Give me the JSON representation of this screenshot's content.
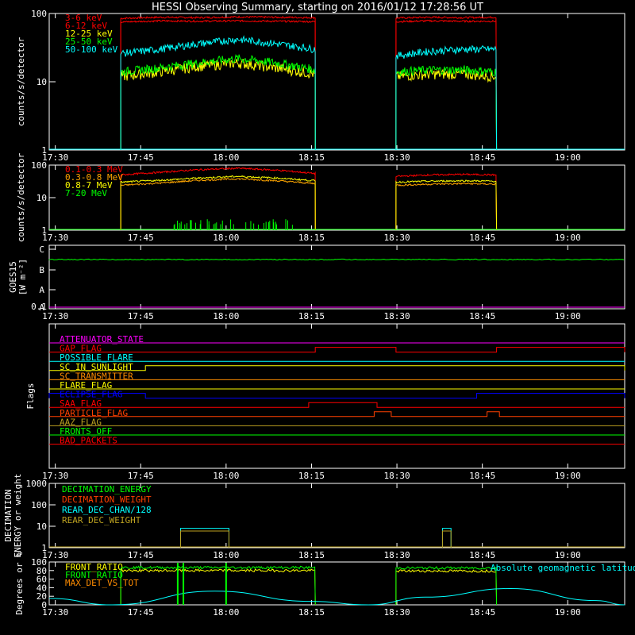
{
  "title": "HESSI Observing Summary, starting on 2016/01/12 17:28:56 UT",
  "time_ticks": [
    "17:30",
    "17:45",
    "18:00",
    "18:15",
    "18:30",
    "18:45",
    "19:00"
  ],
  "colors": {
    "red": "#ff0000",
    "orange": "#ff8c00",
    "yellow": "#ffff00",
    "green": "#00ff00",
    "cyan": "#00ffff",
    "magenta": "#ff00ff",
    "blue": "#0000ff",
    "olive": "#bba020",
    "white": "#ffffff"
  },
  "chart_data": [
    {
      "type": "line",
      "name": "lightcurve-low",
      "ylabel": "counts/s/detector",
      "yscale": "log",
      "ylim": [
        1,
        100
      ],
      "ytick_labels": [
        "1",
        "10",
        "100"
      ],
      "xlim": [
        "17:28:56",
        "19:10:00"
      ],
      "series": [
        {
          "name": "3-6 keV",
          "color": "#ff0000",
          "segments": [
            {
              "start": "17:41:30",
              "end": "18:15:40",
              "values": [
                85,
                88,
                87,
                89,
                88,
                87
              ]
            },
            {
              "start": "18:29:50",
              "end": "18:47:30",
              "values": [
                86,
                88,
                87,
                88
              ]
            }
          ]
        },
        {
          "name": "6-12 keV",
          "color": "#ff0000",
          "segments": [
            {
              "start": "17:41:30",
              "end": "18:15:40",
              "values": [
                75,
                78,
                77,
                78,
                77,
                76
              ]
            },
            {
              "start": "18:29:50",
              "end": "18:47:30",
              "values": [
                76,
                78,
                77,
                77
              ]
            }
          ]
        },
        {
          "name": "12-25 keV",
          "color": "#ffff00",
          "segments": [
            {
              "start": "17:41:30",
              "end": "18:15:40",
              "values": [
                12,
                14,
                17,
                19,
                16,
                13
              ]
            },
            {
              "start": "18:29:50",
              "end": "18:47:30",
              "values": [
                12,
                13,
                13,
                12
              ]
            }
          ]
        },
        {
          "name": "25-50 keV",
          "color": "#00ff00",
          "segments": [
            {
              "start": "17:41:30",
              "end": "18:15:40",
              "values": [
                14,
                16,
                19,
                22,
                19,
                15
              ]
            },
            {
              "start": "18:29:50",
              "end": "18:47:30",
              "values": [
                14,
                15,
                15,
                14
              ]
            }
          ]
        },
        {
          "name": "50-100 keV",
          "color": "#00ffff",
          "segments": [
            {
              "start": "17:41:30",
              "end": "18:15:40",
              "values": [
                26,
                30,
                36,
                42,
                36,
                30
              ]
            },
            {
              "start": "18:29:50",
              "end": "18:47:30",
              "values": [
                24,
                28,
                30,
                30
              ]
            }
          ]
        }
      ]
    },
    {
      "type": "line",
      "name": "lightcurve-high",
      "ylabel": "counts/s/detector",
      "yscale": "log",
      "ylim": [
        1,
        100
      ],
      "ytick_labels": [
        "1",
        "10",
        "100"
      ],
      "series": [
        {
          "name": "0.1-0.3 MeV",
          "color": "#ff0000",
          "segments": [
            {
              "start": "17:41:30",
              "end": "18:15:40",
              "values": [
                50,
                60,
                72,
                80,
                70,
                55
              ]
            },
            {
              "start": "18:29:50",
              "end": "18:47:30",
              "values": [
                45,
                50,
                52,
                50
              ]
            }
          ]
        },
        {
          "name": "0.3-0.8 MeV",
          "color": "#ffa500",
          "segments": [
            {
              "start": "17:41:30",
              "end": "18:15:40",
              "values": [
                24,
                28,
                34,
                38,
                33,
                27
              ]
            },
            {
              "start": "18:29:50",
              "end": "18:47:30",
              "values": [
                24,
                26,
                27,
                26
              ]
            }
          ]
        },
        {
          "name": "0.8-7 MeV",
          "color": "#ffff00",
          "segments": [
            {
              "start": "17:41:30",
              "end": "18:15:40",
              "values": [
                30,
                34,
                40,
                45,
                40,
                33
              ]
            },
            {
              "start": "18:29:50",
              "end": "18:47:30",
              "values": [
                30,
                32,
                33,
                32
              ]
            }
          ]
        },
        {
          "name": "7-20 MeV",
          "color": "#00ff00",
          "segments": []
        }
      ]
    },
    {
      "type": "line",
      "name": "goes",
      "ylabel": "GOES15",
      "ylabel2": "[W m⁻²]",
      "ytick_labels": [
        "A",
        "A",
        "B",
        "C"
      ],
      "ytick_prefix": "0.1",
      "series": [
        {
          "name": "GOES15 flux",
          "color": "#00ff00",
          "level_class": "B-high",
          "values_start": "17:28:56",
          "values_end": "19:10:00"
        }
      ],
      "baseline_color": "#ff00ff"
    },
    {
      "type": "line",
      "name": "flags",
      "ylabel": "Flags",
      "series": [
        {
          "name": "ATTENUATOR_STATE",
          "color": "#ff00ff",
          "on": []
        },
        {
          "name": "GAP_FLAG",
          "color": "#ff0000",
          "on": [
            [
              "18:15:40",
              "18:29:50"
            ],
            [
              "18:47:30",
              "19:10:00"
            ]
          ]
        },
        {
          "name": "POSSIBLE_FLARE",
          "color": "#00ffff",
          "on": []
        },
        {
          "name": "SC_IN_SUNLIGHT",
          "color": "#ffff00",
          "on": [
            [
              "17:45:50",
              "19:10:00"
            ]
          ]
        },
        {
          "name": "SC_TRANSMITTER",
          "color": "#ff8c00",
          "on": []
        },
        {
          "name": "FLARE_FLAG",
          "color": "#ffff00",
          "on": []
        },
        {
          "name": "ECLIPSE_FLAG",
          "color": "#0000ff",
          "on": [
            [
              "17:28:56",
              "17:45:50"
            ],
            [
              "18:44:00",
              "19:10:00"
            ]
          ]
        },
        {
          "name": "SAA_FLAG",
          "color": "#ff0000",
          "on": [
            [
              "18:14:30",
              "18:26:30"
            ]
          ]
        },
        {
          "name": "PARTICLE_FLAG",
          "color": "#ff4000",
          "on": [
            [
              "18:26:00",
              "18:29:00"
            ],
            [
              "18:45:50",
              "18:48:00"
            ]
          ]
        },
        {
          "name": "AAZ_FLAG",
          "color": "#bba020",
          "on": []
        },
        {
          "name": "FRONTS_OFF",
          "color": "#00ff00",
          "on": []
        },
        {
          "name": "BAD_PACKETS",
          "color": "#ff0000",
          "on": []
        }
      ]
    },
    {
      "type": "line",
      "name": "decimation",
      "ylabel": "DECIMATION",
      "ylabel2": "ENERGY or weight",
      "yscale": "log",
      "ylim": [
        1,
        1000
      ],
      "ytick_labels": [
        "1",
        "10",
        "100",
        "1000"
      ],
      "series": [
        {
          "name": "DECIMATION_ENERGY",
          "color": "#00ff00"
        },
        {
          "name": "DECIMATION_WEIGHT",
          "color": "#ff4000"
        },
        {
          "name": "REAR_DEC_CHAN/128",
          "color": "#00ffff",
          "on": [
            [
              "17:52:00",
              "18:00:30",
              8
            ],
            [
              "18:38:00",
              "18:39:30",
              8
            ]
          ]
        },
        {
          "name": "REAR_DEC_WEIGHT",
          "color": "#bba020",
          "on": [
            [
              "17:52:00",
              "18:00:30",
              6
            ],
            [
              "18:38:00",
              "18:39:30",
              6
            ]
          ]
        }
      ]
    },
    {
      "type": "line",
      "name": "ratios",
      "ylabel": "Degrees or %",
      "ylim": [
        0,
        100
      ],
      "ytick_labels": [
        "0",
        "20",
        "40",
        "60",
        "80",
        "100"
      ],
      "annotation": "Absolute geomagnetic latitude",
      "series": [
        {
          "name": "FRONT_RATIO",
          "color": "#ffff00",
          "segments": [
            {
              "start": "17:41:30",
              "end": "18:15:40",
              "value": 80
            },
            {
              "start": "18:29:50",
              "end": "18:47:30",
              "value": 79
            }
          ]
        },
        {
          "name": "FRONT_RATIO",
          "color": "#00ff00",
          "segments": [
            {
              "start": "17:41:30",
              "end": "18:15:40",
              "value": 87
            },
            {
              "start": "18:29:50",
              "end": "18:47:30",
              "value": 86
            }
          ]
        },
        {
          "name": "MAX_DET_VS_TOT",
          "color": "#ff8c00",
          "segments": []
        },
        {
          "name": "Absolute geomagnetic latitude",
          "color": "#00ffff",
          "x": [
            "17:28:56",
            "17:40",
            "17:58",
            "18:15",
            "18:25",
            "18:35",
            "18:50",
            "19:05",
            "19:10"
          ],
          "values": [
            15,
            0,
            32,
            8,
            0,
            18,
            38,
            10,
            0
          ]
        }
      ]
    }
  ]
}
